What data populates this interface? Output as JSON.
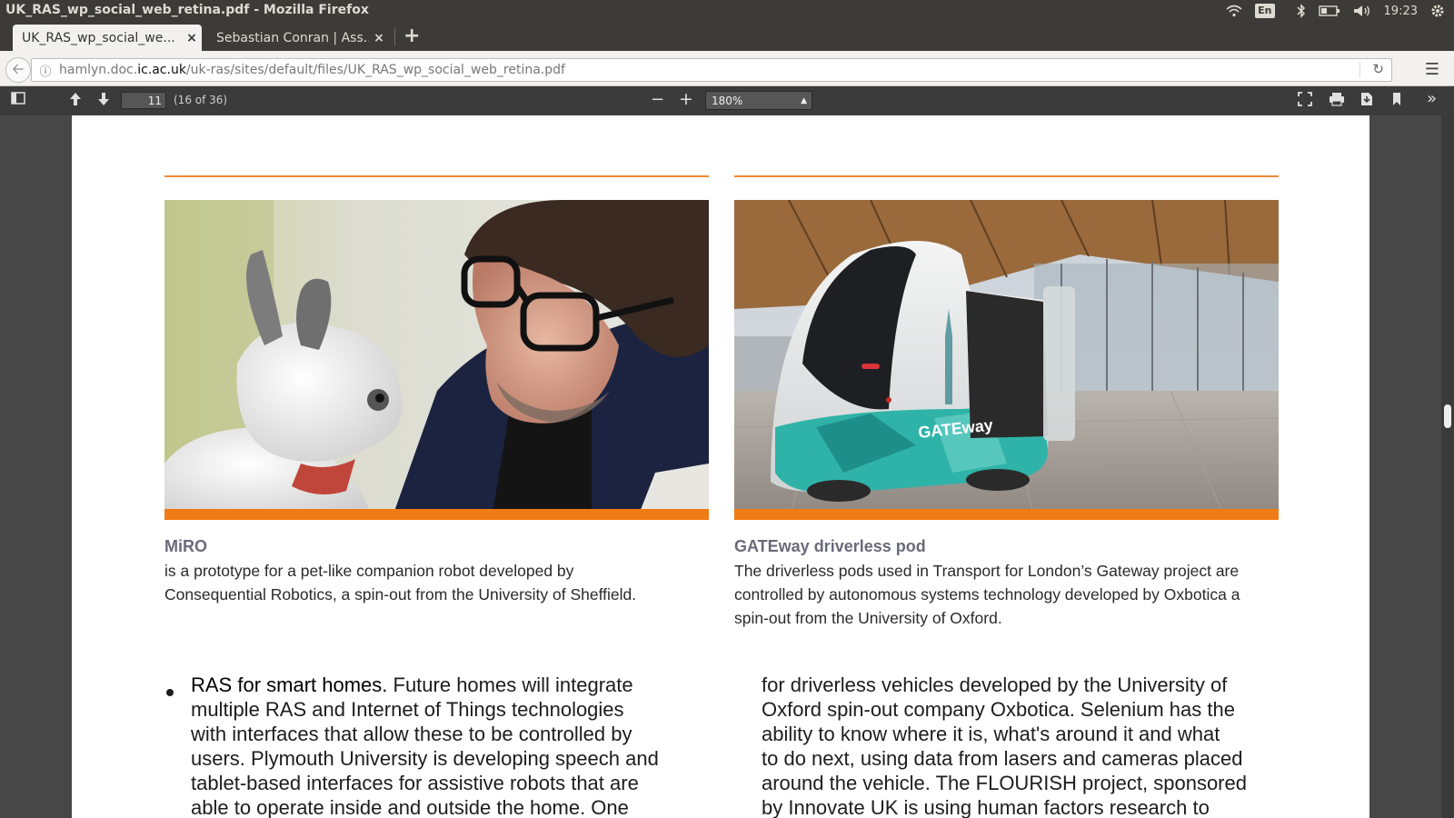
{
  "window": {
    "title": "UK_RAS_wp_social_web_retina.pdf - Mozilla Firefox"
  },
  "tray": {
    "lang": "En",
    "time": "19:23"
  },
  "tabs": [
    {
      "label": "UK_RAS_wp_social_we...",
      "close": "×"
    },
    {
      "label": "Sebastian Conran | Ass...",
      "close": "×"
    }
  ],
  "newtab_label": "+",
  "nav": {
    "url_prefix": "hamlyn.doc.",
    "url_domain": "ic.ac.uk",
    "url_path": "/uk-ras/sites/default/files/UK_RAS_wp_social_web_retina.pdf"
  },
  "pdf_toolbar": {
    "page_number": "11",
    "page_count": "(16 of 36)",
    "zoom": "180%",
    "zoom_out": "−",
    "zoom_in": "+"
  },
  "document": {
    "left_caption_title": "MiRO",
    "left_caption_lines": [
      "is a prototype for a pet-like companion robot developed by",
      "Consequential Robotics, a spin-out from the University of Sheffield."
    ],
    "right_caption_title": "GATEway driverless pod",
    "right_caption_lines": [
      "The driverless pods used in Transport for London’s Gateway project are",
      "controlled by autonomous systems technology developed by Oxbotica a",
      "spin-out from the University of Oxford."
    ],
    "left_bullet_heading": "RAS for smart homes.",
    "left_lines": [
      " Future homes will integrate",
      "multiple RAS and Internet of Things technologies",
      "with interfaces that allow these to be controlled by",
      "users. Plymouth University is developing speech and",
      "tablet-based interfaces for assistive robots that are",
      "able to operate inside and outside the home. One"
    ],
    "right_lines": [
      "for driverless vehicles developed by the University of",
      "Oxford spin-out company Oxbotica. Selenium has the",
      "ability to know where it is, what's around it and what",
      "to do next, using data from lasers and cameras placed",
      "around the vehicle. The FLOURISH project, sponsored",
      "by Innovate UK is using human factors research to"
    ],
    "pod_logo": "GATEway"
  }
}
